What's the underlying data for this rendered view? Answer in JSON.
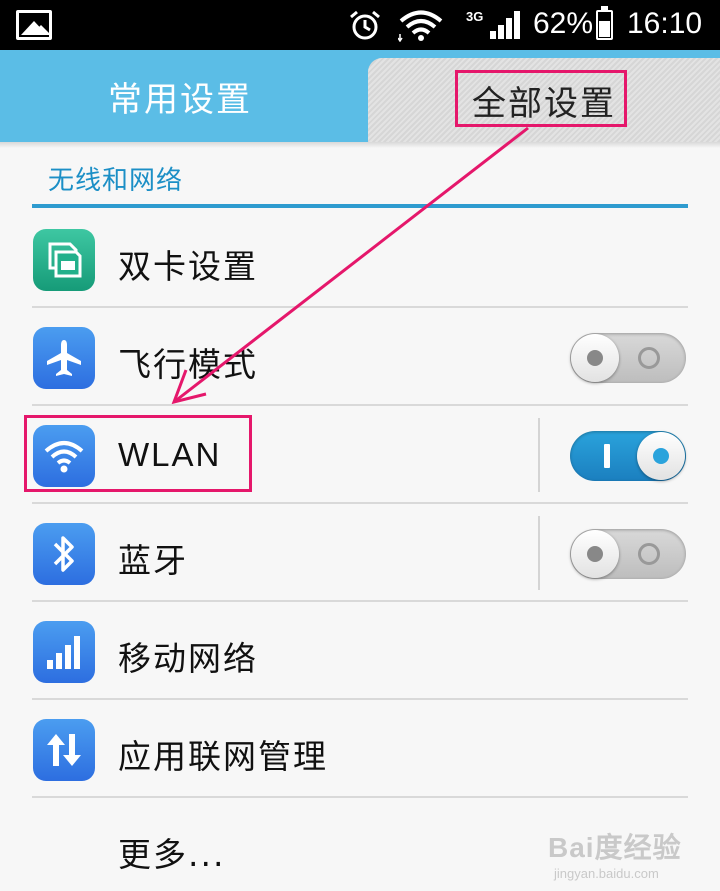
{
  "status_bar": {
    "network_type": "3G",
    "battery_percent": "62%",
    "battery_level": 0.62,
    "time": "16:10",
    "icons": [
      "gallery-icon",
      "alarm-icon",
      "wifi-icon",
      "signal-icon",
      "battery-icon"
    ]
  },
  "tabs": [
    {
      "label": "常用设置",
      "selected": false
    },
    {
      "label": "全部设置",
      "selected": true
    }
  ],
  "section": {
    "title": "无线和网络"
  },
  "rows": [
    {
      "label": "双卡设置",
      "icon": "dual-sim-icon"
    },
    {
      "label": "飞行模式",
      "icon": "airplane-icon",
      "toggle": "off"
    },
    {
      "label": "WLAN",
      "icon": "wifi-icon",
      "toggle": "on"
    },
    {
      "label": "蓝牙",
      "icon": "bluetooth-icon",
      "toggle": "off"
    },
    {
      "label": "移动网络",
      "icon": "mobile-network-icon"
    },
    {
      "label": "应用联网管理",
      "icon": "app-network-icon"
    },
    {
      "label": "更多..."
    }
  ],
  "watermark": {
    "brand": "Bai度经验",
    "url": "jingyan.baidu.com"
  },
  "colors": {
    "tab_bar": "#5bbde6",
    "section_accent": "#1c8fc6",
    "annotation": "#e5176b",
    "toggle_on": "#2aa3dc"
  }
}
